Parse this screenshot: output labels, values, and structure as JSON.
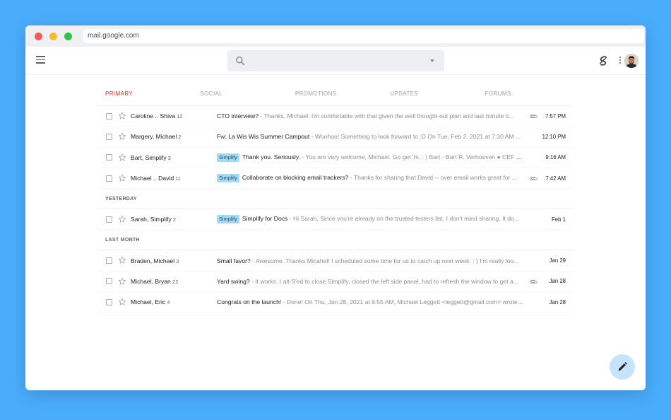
{
  "browser": {
    "url": "mail.google.com",
    "traffic_lights": [
      "#f25e57",
      "#f9bb2d",
      "#27c840"
    ]
  },
  "search": {
    "placeholder": ""
  },
  "tabs": [
    {
      "label": "PRIMARY",
      "active": true
    },
    {
      "label": "SOCIAL",
      "active": false
    },
    {
      "label": "PROMOTIONS",
      "active": false
    },
    {
      "label": "UPDATES",
      "active": false
    },
    {
      "label": "FORUMS",
      "active": false
    }
  ],
  "sections": {
    "today": [
      {
        "sender": "Caroline .. Shiva",
        "count": "12",
        "label": "",
        "subject": "CTO interview?",
        "snippet": " - Thanks, Michael. I'm comfortable with that given the well thought-out plan and last minute ti...",
        "attachment": true,
        "time": "7:57 PM"
      },
      {
        "sender": "Margery, Michael",
        "count": "2",
        "label": "",
        "subject": "Fw: La Wis Wis Summer Campout",
        "snippet": " - Woohoo! Something to look forward to :D On Tue, Feb 2, 2021 at 7:30 AM ...",
        "attachment": false,
        "time": "12:10 PM"
      },
      {
        "sender": "Bart, Simplify",
        "count": "3",
        "label": "Simplify",
        "subject": "Thank you. Seriously.",
        "snippet": " - You are very welcome, Michael. Go get 'm. : ) Bart - Bart R. Verhoeven ● CEF S...",
        "attachment": false,
        "time": "9:16 AM"
      },
      {
        "sender": "Michael .. David",
        "count": "11",
        "label": "Simplify",
        "subject": "Collaborate on blocking email trackers?",
        "snippet": " - Thanks for sharing that David -- over email works great for ...",
        "attachment": true,
        "time": "7:42 AM"
      }
    ],
    "yesterday_heading": "YESTERDAY",
    "yesterday": [
      {
        "sender": "Sarah, Simplify",
        "count": "2",
        "label": "Simplify",
        "subject": "Simplify for Docs",
        "snippet": " - Hi Sarah, Since you're already on the trusted testers list, I don't mind sharing. It do...",
        "attachment": false,
        "time": "Feb 1"
      }
    ],
    "last_month_heading": "LAST MONTH",
    "last_month": [
      {
        "sender": "Braden, Michael",
        "count": "3",
        "label": "",
        "subject": "Small favor?",
        "snippet": " - Awesome. Thanks Micahel! I scheduled some time for us to catch up next week. : ) I'm really loo...",
        "attachment": false,
        "time": "Jan 29"
      },
      {
        "sender": "Michael, Bryan",
        "count": "22",
        "label": "",
        "subject": "Yard swing?",
        "snippet": " - It works, I alt-S'ed to close Simplify, closed the left side panel, had to refresh the window to get a...",
        "attachment": true,
        "time": "Jan 28"
      },
      {
        "sender": "Michael, Eric",
        "count": "4",
        "label": "",
        "subject": "Congrats on the launch!",
        "snippet": " - Done! On Thu, Jan 28, 2021 at 9:55 AM, Michael Leggett <leggett@gmail.com> wrote...",
        "attachment": false,
        "time": "Jan 28"
      }
    ]
  },
  "icons": {
    "menu": "hamburger-icon",
    "search": "search-icon",
    "simplify": "simplify-logo-icon",
    "more": "more-vert-icon",
    "compose": "pencil-icon",
    "attachment": "paperclip-icon",
    "star": "star-outline-icon"
  }
}
